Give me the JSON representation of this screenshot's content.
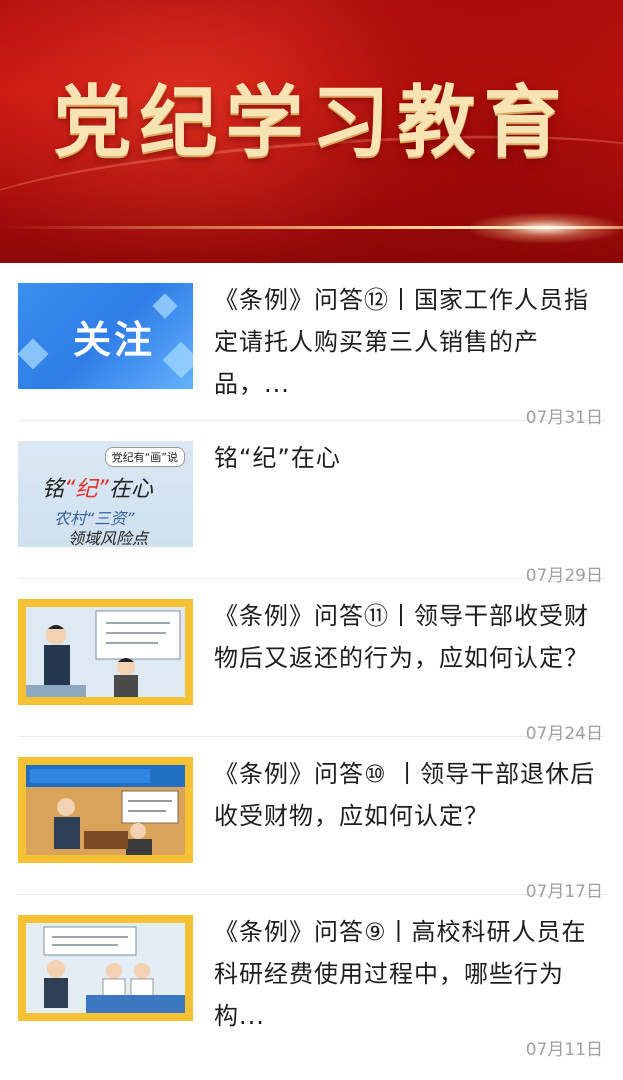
{
  "banner": {
    "title": "党纪学习教育"
  },
  "articles": [
    {
      "title": "《条例》问答⑫丨国家工作人员指定请托人购买第三人销售的产品，...",
      "date": "07月31日",
      "thumb_icon": "guanzhu-thumbnail",
      "thumb_text": "关注"
    },
    {
      "title": "铭“纪”在心",
      "date": "07月29日",
      "thumb_icon": "mingji-thumbnail",
      "thumb_tag": "党纪有“画”说",
      "thumb_line1_a": "铭",
      "thumb_line1_b": "“纪”",
      "thumb_line1_c": "在心",
      "thumb_line2": "农村“三资”",
      "thumb_line3": "领域风险点"
    },
    {
      "title": "《条例》问答⑪丨领导干部收受财物后又返还的行为，应如何认定？",
      "date": "07月24日",
      "thumb_icon": "comic-thumbnail"
    },
    {
      "title": "《条例》问答⑩ 丨领导干部退休后收受财物，应如何认定？",
      "date": "07月17日",
      "thumb_icon": "comic-thumbnail"
    },
    {
      "title": "《条例》问答⑨丨高校科研人员在科研经费使用过程中，哪些行为构...",
      "date": "07月11日",
      "thumb_icon": "comic-thumbnail"
    }
  ],
  "colors": {
    "banner_red": "#c8150f",
    "title_gold": "#f7e3b4",
    "date_gray": "#a0a0a0",
    "comic_frame": "#f6c233"
  }
}
